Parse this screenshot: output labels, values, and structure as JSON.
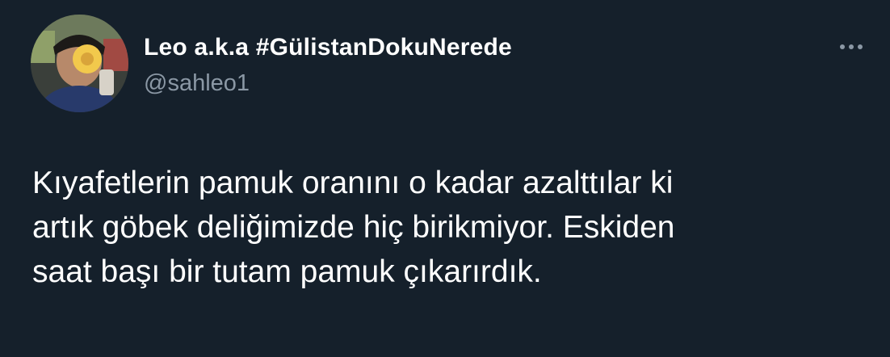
{
  "tweet": {
    "author": {
      "display_name": "Leo a.k.a #GülistanDokuNerede",
      "handle": "@sahleo1"
    },
    "text_lines": [
      "Kıyafetlerin pamuk oranını o kadar azalttılar ki",
      "artık göbek deliğimizde hiç birikmiyor. Eskiden",
      "saat başı bir tutam pamuk çıkarırdık."
    ]
  },
  "icons": {
    "more": "more-horizontal-icon"
  },
  "colors": {
    "background": "#15202b",
    "primary_text": "#ffffff",
    "secondary_text": "#8b98a5"
  }
}
